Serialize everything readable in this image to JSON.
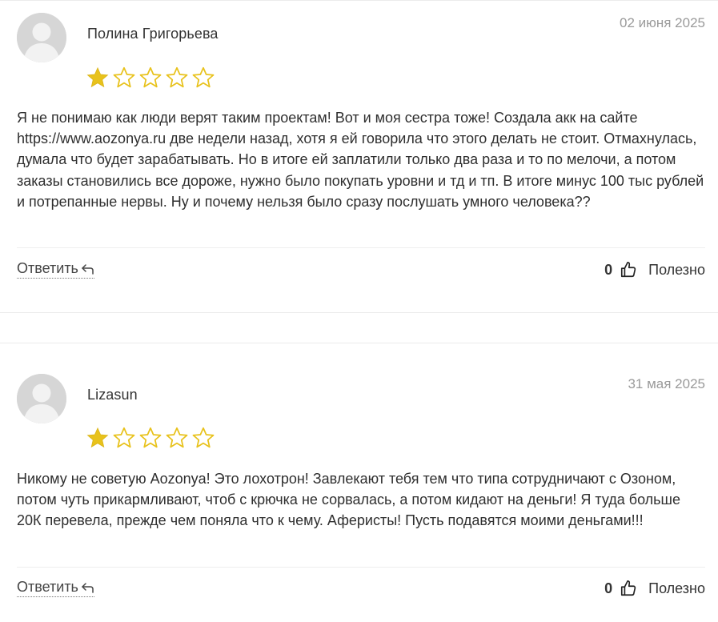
{
  "reviews": [
    {
      "author": "Полина Григорьева",
      "date": "02 июня 2025",
      "rating": 1,
      "max_rating": 5,
      "text": "Я не понимаю как люди верят таким проектам! Вот и моя сестра тоже! Создала акк на сайте https://www.aozonya.ru две недели назад, хотя я ей говорила что этого делать не стоит. Отмахнулась, думала что будет зарабатывать. Но в итоге ей заплатили только два раза и то по мелочи, а потом заказы становились все дороже, нужно было покупать уровни и тд и тп. В итоге минус 100 тыс рублей и потрепанные нервы. Ну и почему нельзя было сразу послушать умного человека??",
      "reply_label": "Ответить",
      "helpful_count": "0",
      "helpful_label": "Полезно"
    },
    {
      "author": "Lizasun",
      "date": "31 мая 2025",
      "rating": 1,
      "max_rating": 5,
      "text": "Никому не советую Aozonya! Это лохотрон! Завлекают тебя тем что типа сотрудничают с Озоном, потом чуть прикармливают, чтоб с крючка не сорвалась, а потом кидают на деньги! Я туда больше 20К перевела, прежде чем поняла что к чему. Аферисты! Пусть подавятся моими деньгами!!!",
      "reply_label": "Ответить",
      "helpful_count": "0",
      "helpful_label": "Полезно"
    }
  ],
  "icons": {
    "avatar": "default-user-avatar-icon",
    "star_filled": "star-filled-icon",
    "star_empty": "star-outline-icon",
    "reply": "reply-arrow-icon",
    "helpful": "thumbs-up-icon"
  },
  "colors": {
    "star": "#e8c21c",
    "text": "#2f2f2f",
    "date": "#9a9a9a",
    "avatar_bg": "#d9d9d9"
  }
}
